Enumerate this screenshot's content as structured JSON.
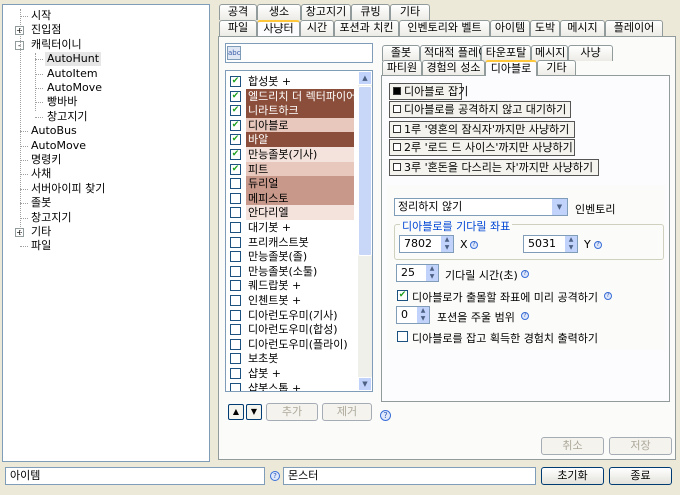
{
  "tree": {
    "items": [
      {
        "label": "시작",
        "level": 0,
        "toggle": ""
      },
      {
        "label": "진입점",
        "level": 0,
        "toggle": "+"
      },
      {
        "label": "캐릭터이니",
        "level": 0,
        "toggle": "-"
      },
      {
        "label": "AutoHunt",
        "level": 1,
        "toggle": "",
        "selected": true
      },
      {
        "label": "AutoItem",
        "level": 1,
        "toggle": ""
      },
      {
        "label": "AutoMove",
        "level": 1,
        "toggle": ""
      },
      {
        "label": "빵바바",
        "level": 1,
        "toggle": ""
      },
      {
        "label": "창고지기",
        "level": 1,
        "toggle": ""
      },
      {
        "label": "AutoBus",
        "level": 0,
        "toggle": ""
      },
      {
        "label": "AutoMove",
        "level": 0,
        "toggle": ""
      },
      {
        "label": "명령키",
        "level": 0,
        "toggle": ""
      },
      {
        "label": "사채",
        "level": 0,
        "toggle": ""
      },
      {
        "label": "서버아이피 찾기",
        "level": 0,
        "toggle": ""
      },
      {
        "label": "졸봇",
        "level": 0,
        "toggle": ""
      },
      {
        "label": "창고지기",
        "level": 0,
        "toggle": ""
      },
      {
        "label": "기타",
        "level": 0,
        "toggle": "+"
      },
      {
        "label": "파일",
        "level": 0,
        "toggle": ""
      }
    ]
  },
  "tabs_row1": [
    "공격",
    "생소",
    "창고지기",
    "큐빙",
    "기타"
  ],
  "tabs_row2": [
    "파일",
    "사냥터",
    "시간",
    "포션과 치킨",
    "인벤토리와 벨트",
    "아이템",
    "도박",
    "메시지",
    "플레이어"
  ],
  "subtabs_row1": [
    "졸봇",
    "적대적 플레이어",
    "타운포탈",
    "메시지",
    "사냥"
  ],
  "subtabs_row2": [
    "파티원",
    "경험의 성소",
    "디아블로",
    "기타"
  ],
  "hunt_list": {
    "items": [
      {
        "label": "합성봇 +",
        "checked": true,
        "color": ""
      },
      {
        "label": "엘드리치 더 렉터파이어",
        "checked": true,
        "color": "#8b4e3a"
      },
      {
        "label": "니라트하크",
        "checked": true,
        "color": "#8b4e3a"
      },
      {
        "label": "디아블로",
        "checked": true,
        "color": "#e8c8bc"
      },
      {
        "label": "바알",
        "checked": true,
        "color": "#8b4e3a"
      },
      {
        "label": "만능졸봇(기사)",
        "checked": true,
        "color": "#f4e2dc"
      },
      {
        "label": "피트",
        "checked": true,
        "color": "#e8c8bc"
      },
      {
        "label": "듀리얼",
        "checked": false,
        "color": "#c8998b"
      },
      {
        "label": "메피스토",
        "checked": false,
        "color": "#c8998b"
      },
      {
        "label": "안다리엘",
        "checked": false,
        "color": "#f4e2dc"
      },
      {
        "label": "대기봇 +",
        "checked": false,
        "color": ""
      },
      {
        "label": "프리캐스트봇",
        "checked": false,
        "color": ""
      },
      {
        "label": "만능졸봇(졸)",
        "checked": false,
        "color": ""
      },
      {
        "label": "만능졸봇(소툴)",
        "checked": false,
        "color": ""
      },
      {
        "label": "퀘드랍봇 +",
        "checked": false,
        "color": ""
      },
      {
        "label": "인첸트봇 +",
        "checked": false,
        "color": ""
      },
      {
        "label": "디아런도우미(기사)",
        "checked": false,
        "color": ""
      },
      {
        "label": "디아런도우미(합성)",
        "checked": false,
        "color": ""
      },
      {
        "label": "디아런도우미(플라이)",
        "checked": false,
        "color": ""
      },
      {
        "label": "보초봇",
        "checked": false,
        "color": ""
      },
      {
        "label": "샵봇 +",
        "checked": false,
        "color": ""
      },
      {
        "label": "샵봇스톱 +",
        "checked": false,
        "color": ""
      }
    ],
    "add_label": "추가",
    "remove_label": "제거"
  },
  "diablo": {
    "options": [
      {
        "label": "디아블로 잡기",
        "on": true
      },
      {
        "label": "디아블로를 공격하지 않고 대기하기",
        "on": false
      },
      {
        "label": "1루 '영혼의 잠식자'까지만 사냥하기",
        "on": false
      },
      {
        "label": "2루 '로드 드 사이스'까지만 사냥하기",
        "on": false
      },
      {
        "label": "3루 '혼돈을 다스리는 자'까지만 사냥하기",
        "on": false
      }
    ],
    "inventory_select": "정리하지 않기",
    "inventory_label": "인벤토리",
    "coord_group_title": "디아블로를 기다릴 좌표",
    "x_value": "7802",
    "x_label": "X",
    "y_value": "5031",
    "y_label": "Y",
    "wait_value": "25",
    "wait_label": "기다릴 시간(초)",
    "attack_label": "디아블로가 출몰할 좌표에 미리 공격하기",
    "attack_checked": true,
    "potion_value": "0",
    "potion_label": "포션을 주울 범위",
    "exp_label": "디아블로를 잡고 획득한 경험치 출력하기",
    "exp_checked": false
  },
  "footer": {
    "cancel_label": "취소",
    "save_label": "저장",
    "item_input": "아이템",
    "monster_input": "몬스터",
    "reset_label": "초기화",
    "exit_label": "종료"
  }
}
